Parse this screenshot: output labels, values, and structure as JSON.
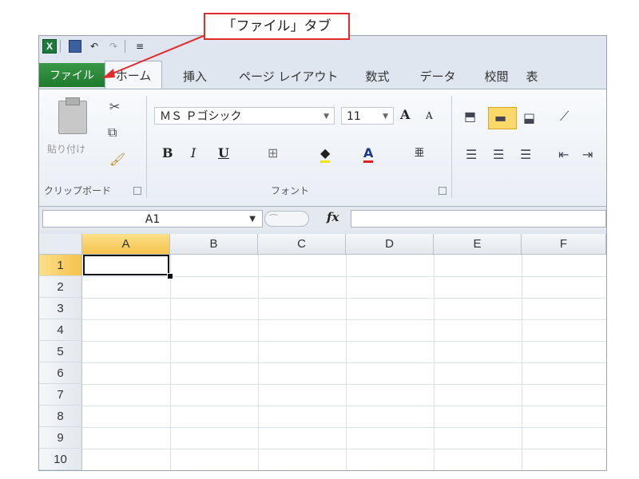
{
  "callout": {
    "text": "「ファイル」タブ",
    "color": "#e32b2b"
  },
  "qat": {
    "undo": "↶",
    "redo": "↷",
    "customize": "≡"
  },
  "tabs": [
    {
      "label": "ファイル"
    },
    {
      "label": "ホーム"
    },
    {
      "label": "挿入"
    },
    {
      "label": "ページ レイアウト"
    },
    {
      "label": "数式"
    },
    {
      "label": "データ"
    },
    {
      "label": "校閲"
    },
    {
      "label": "表"
    }
  ],
  "ribbon": {
    "clipboard": {
      "paste": "貼り付け",
      "group": "クリップボード"
    },
    "font": {
      "name": "ＭＳ Ｐゴシック",
      "size": "11",
      "grow": "A",
      "shrink": "A",
      "bold": "B",
      "italic": "I",
      "underline": "U",
      "color_letter": "A",
      "group": "フォント"
    }
  },
  "formula_bar": {
    "name_box": "A1",
    "fx": "fx"
  },
  "grid": {
    "columns": [
      "A",
      "B",
      "C",
      "D",
      "E",
      "F"
    ],
    "rows": [
      "1",
      "2",
      "3",
      "4",
      "5",
      "6",
      "7",
      "8",
      "9",
      "10"
    ],
    "selected_cell": "A1"
  },
  "colors": {
    "file_tab": "#1f7a2c",
    "header_selected": "#f5c24c",
    "accent_red": "#e32b2b"
  }
}
